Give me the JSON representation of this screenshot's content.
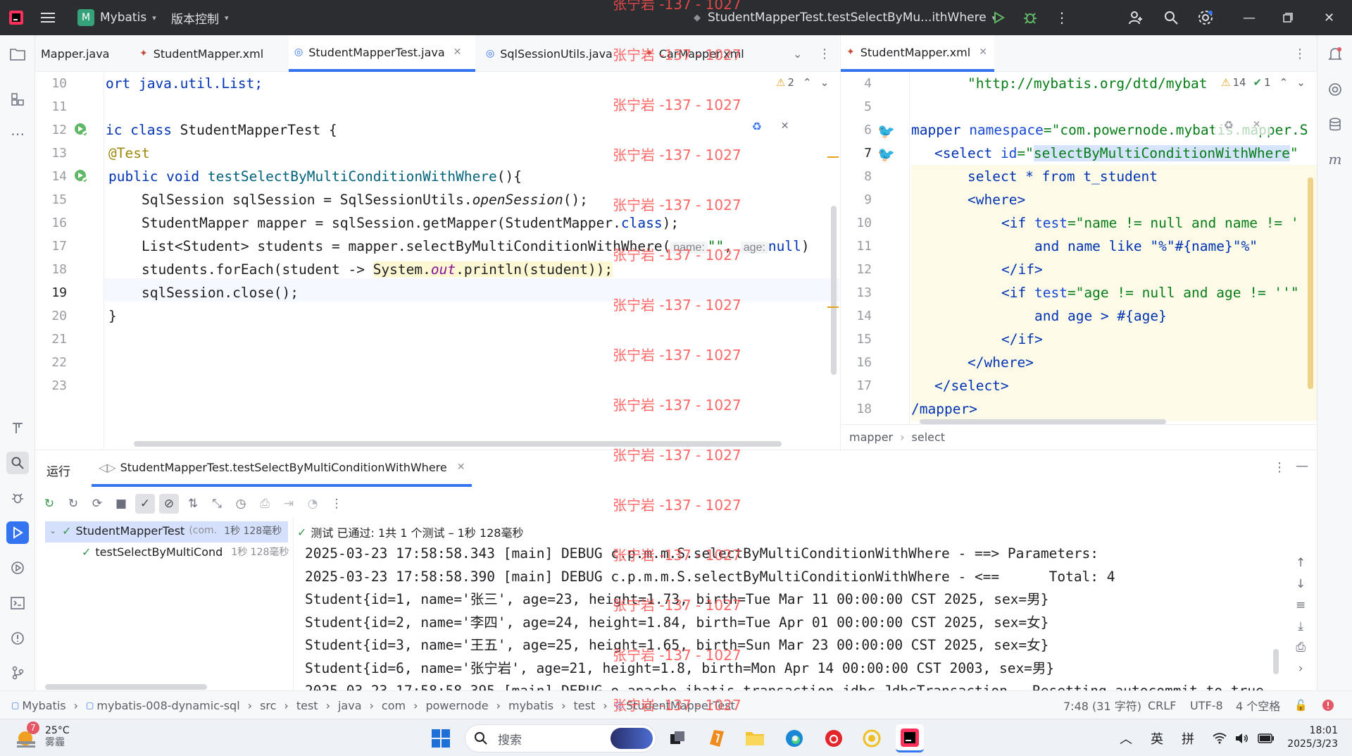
{
  "titlebar": {
    "project_badge": "M",
    "project_name": "Mybatis",
    "vcs_label": "版本控制",
    "run_config": "StudentMapperTest.testSelectByMu...ithWhere"
  },
  "left_tabs": [
    {
      "label": "Mapper.java"
    },
    {
      "label": "StudentMapper.xml"
    },
    {
      "label": "StudentMapperTest.java"
    },
    {
      "label": "SqlSessionUtils.java"
    },
    {
      "label": "CarMapper.xml"
    }
  ],
  "right_tab": {
    "label": "StudentMapper.xml"
  },
  "left_editor": {
    "warning_count": "2",
    "line_numbers": [
      "10",
      "11",
      "12",
      "13",
      "14",
      "15",
      "16",
      "17",
      "18",
      "19",
      "20",
      "21",
      "22",
      "23"
    ],
    "lines": {
      "l10": "ort java.util.List;",
      "l12a": "ic ",
      "l12b": "class",
      "l12c": " StudentMapperTest {",
      "l13": "@Test",
      "l14a": "public void ",
      "l14b": "testSelectByMultiConditionWithWhere",
      "l14c": "(){",
      "l15a": "    SqlSession sqlSession = SqlSessionUtils.",
      "l15b": "openSession",
      "l15c": "();",
      "l16a": "    StudentMapper mapper = sqlSession.getMapper(StudentMapper.",
      "l16b": "class",
      "l16c": ");",
      "l17a": "    List<Student> students = mapper.selectByMultiConditionWithWhere(",
      "l17hint1": "name:",
      "l17str": "\"\"",
      "l17comma": ",",
      "l17hint2": "age:",
      "l17null": "null",
      "l17end": ")",
      "l18a": "    students.forEach(student -> ",
      "l18b": "System.",
      "l18c": "out",
      "l18d": ".println(student));",
      "l19": "    sqlSession.close();",
      "l20": "}"
    }
  },
  "right_editor": {
    "warning_count": "14",
    "ok_count": "1",
    "line_numbers": [
      "4",
      "5",
      "6",
      "7",
      "8",
      "9",
      "10",
      "11",
      "12",
      "13",
      "14",
      "15",
      "16",
      "17",
      "18"
    ],
    "lines": {
      "l4": "\"http://mybatis.org/dtd/mybat",
      "l6a": "mapper ",
      "l6b": "namespace",
      "l6c": "=\"com.powernode.mybatis.mapper.S",
      "l7a": "<select ",
      "l7b": "id",
      "l7c": "=\"",
      "l7d": "selectByMultiConditionWithWhere",
      "l7e": "\"",
      "l8": "select * from t_student",
      "l9": "<where>",
      "l10a": "<if ",
      "l10b": "test",
      "l10c": "=\"name != null and name != '",
      "l11": "and name like \"%\"#{name}\"%\"",
      "l12": "</if>",
      "l13a": "<if ",
      "l13b": "test",
      "l13c": "=\"age != null and age != ''\"",
      "l14": "and age > #{age}",
      "l15": "</if>",
      "l16": "</where>",
      "l17": "</select>",
      "l18": "/mapper>"
    },
    "breadcrumb": [
      "mapper",
      "select"
    ]
  },
  "watermark": "张宁岩 -137 - 1027",
  "run_panel": {
    "tool_title": "运行",
    "tab_label": "StudentMapperTest.testSelectByMultiConditionWithWhere",
    "status_text": "测试 已通过: 1共 1 个测试 – 1秒 128毫秒",
    "tree": [
      {
        "label": "StudentMapperTest",
        "extra": "(com.",
        "time": "1秒 128毫秒"
      },
      {
        "label": "testSelectByMultiCond",
        "time": "1秒 128毫秒"
      }
    ],
    "console": [
      "2025-03-23 17:58:58.343 [main] DEBUG c.p.m.m.S.selectByMultiConditionWithWhere - ==> Parameters: ",
      "2025-03-23 17:58:58.390 [main] DEBUG c.p.m.m.S.selectByMultiConditionWithWhere - <==      Total: 4",
      "Student{id=1, name='张三', age=23, height=1.73, birth=Tue Mar 11 00:00:00 CST 2025, sex=男}",
      "Student{id=2, name='李四', age=24, height=1.84, birth=Tue Apr 01 00:00:00 CST 2025, sex=女}",
      "Student{id=3, name='王五', age=25, height=1.65, birth=Sun Mar 23 00:00:00 CST 2025, sex=女}",
      "Student{id=6, name='张宁岩', age=21, height=1.8, birth=Mon Apr 14 00:00:00 CST 2003, sex=男}",
      "2025-03-23 17:58:58.395 [main] DEBUG o.apache.ibatis.transaction.jdbc.JdbcTransaction - Resetting autocommit to true"
    ]
  },
  "statusbar": {
    "breadcrumbs": [
      "Mybatis",
      "mybatis-008-dynamic-sql",
      "src",
      "test",
      "java",
      "com",
      "powernode",
      "mybatis",
      "test",
      "StudentMapperTest"
    ],
    "position": "7:48 (31 字符)",
    "line_sep": "CRLF",
    "encoding": "UTF-8",
    "indent": "4 个空格"
  },
  "taskbar": {
    "weather_temp": "25°C",
    "weather_desc": "雾霾",
    "weather_badge": "7",
    "search_placeholder": "搜索",
    "ime1": "英",
    "ime2": "拼",
    "time": "18:01",
    "date": "2025/3/23"
  }
}
